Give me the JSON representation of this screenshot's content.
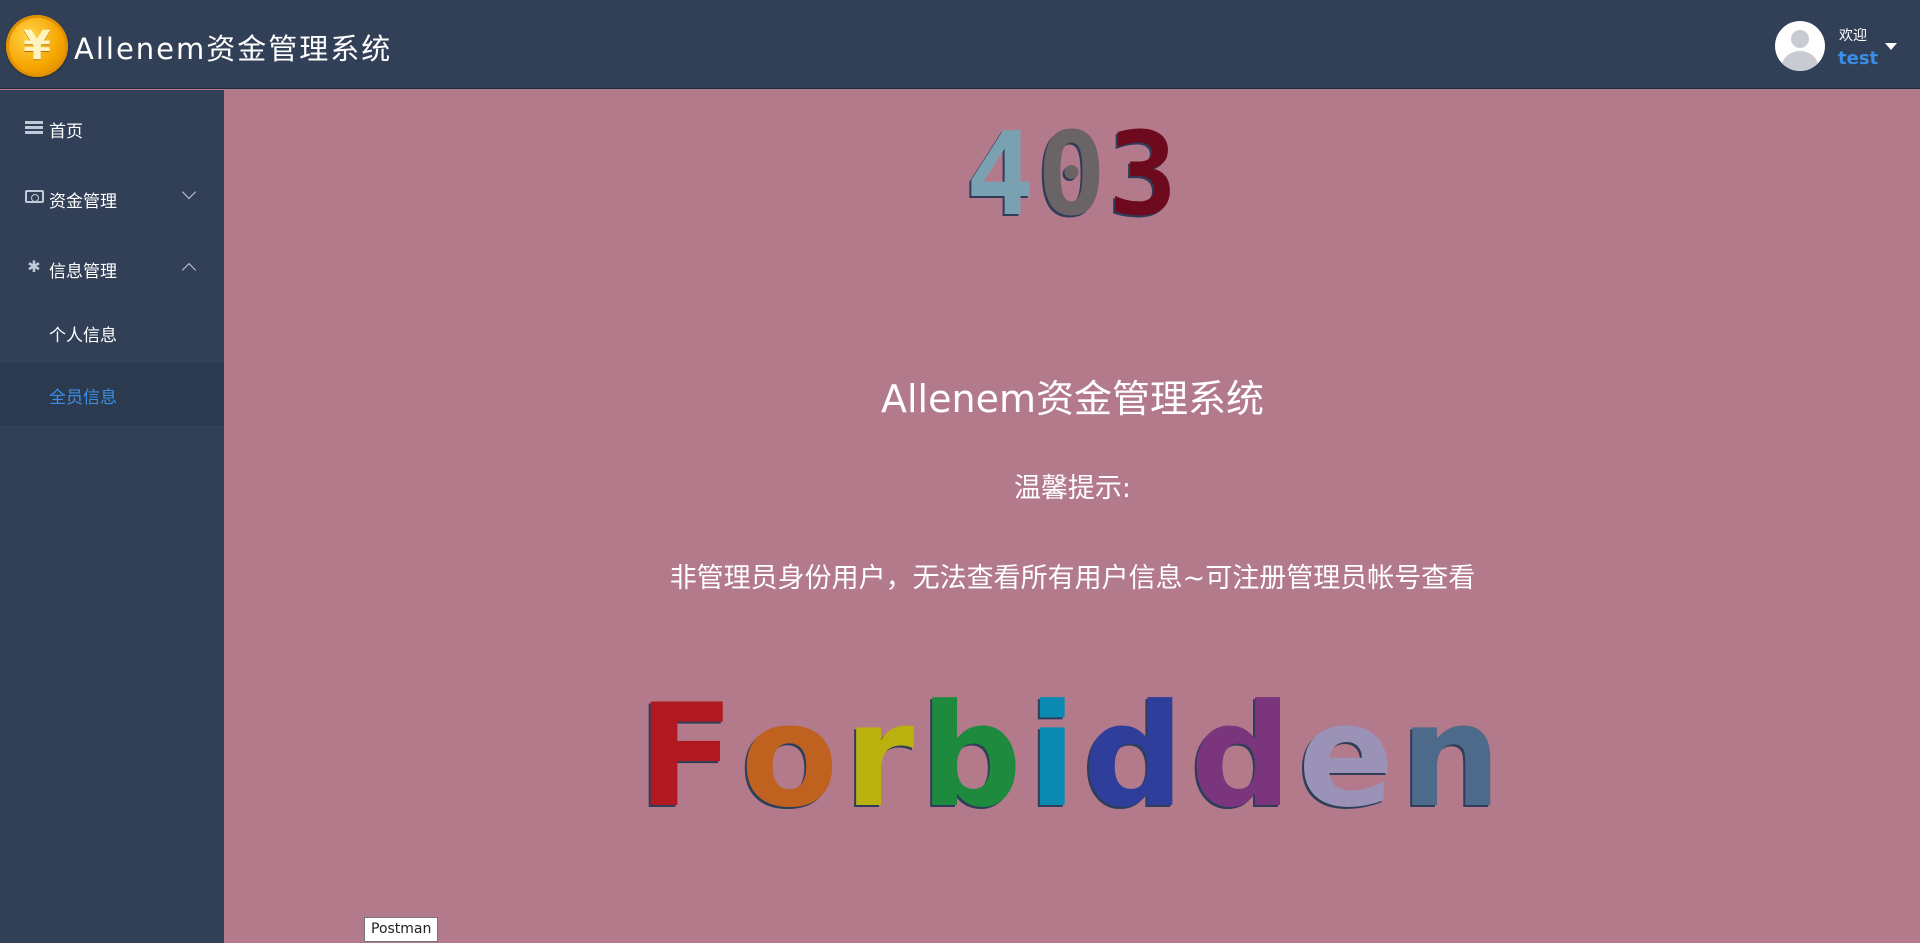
{
  "header": {
    "logo_symbol": "¥",
    "title": "Allenem资金管理系统",
    "welcome": "欢迎",
    "username": "test"
  },
  "sidebar": {
    "items": [
      {
        "label": "首页",
        "icon": "list-icon"
      },
      {
        "label": "资金管理",
        "icon": "cash-icon",
        "expanded": false
      },
      {
        "label": "信息管理",
        "icon": "gear-icon",
        "expanded": true
      }
    ],
    "sub_items": [
      {
        "label": "个人信息",
        "active": false
      },
      {
        "label": "全员信息",
        "active": true
      }
    ]
  },
  "main": {
    "code_digits": [
      "4",
      "0",
      "3"
    ],
    "code_colors": [
      "#7aa1b2",
      "#6b6467",
      "#6e0a1e"
    ],
    "system_name": "Allenem资金管理系统",
    "tip_title": "温馨提示:",
    "tip_text": "非管理员身份用户，无法查看所有用户信息~可注册管理员帐号查看",
    "forbidden_letters": [
      "F",
      "o",
      "r",
      "b",
      "i",
      "d",
      "d",
      "e",
      "n"
    ],
    "forbidden_colors": [
      "#b0191f",
      "#c0621f",
      "#bab10e",
      "#1e8a3e",
      "#0a8ab0",
      "#2e3e9a",
      "#7a357d",
      "#9a92b7",
      "#4e6a8a"
    ]
  },
  "tooltip": {
    "text": "Postman"
  },
  "colors": {
    "header_bg": "#324057",
    "sidebar_bg": "#324057",
    "content_bg": "#b37a8b",
    "active_blue": "#3a8ee6"
  }
}
